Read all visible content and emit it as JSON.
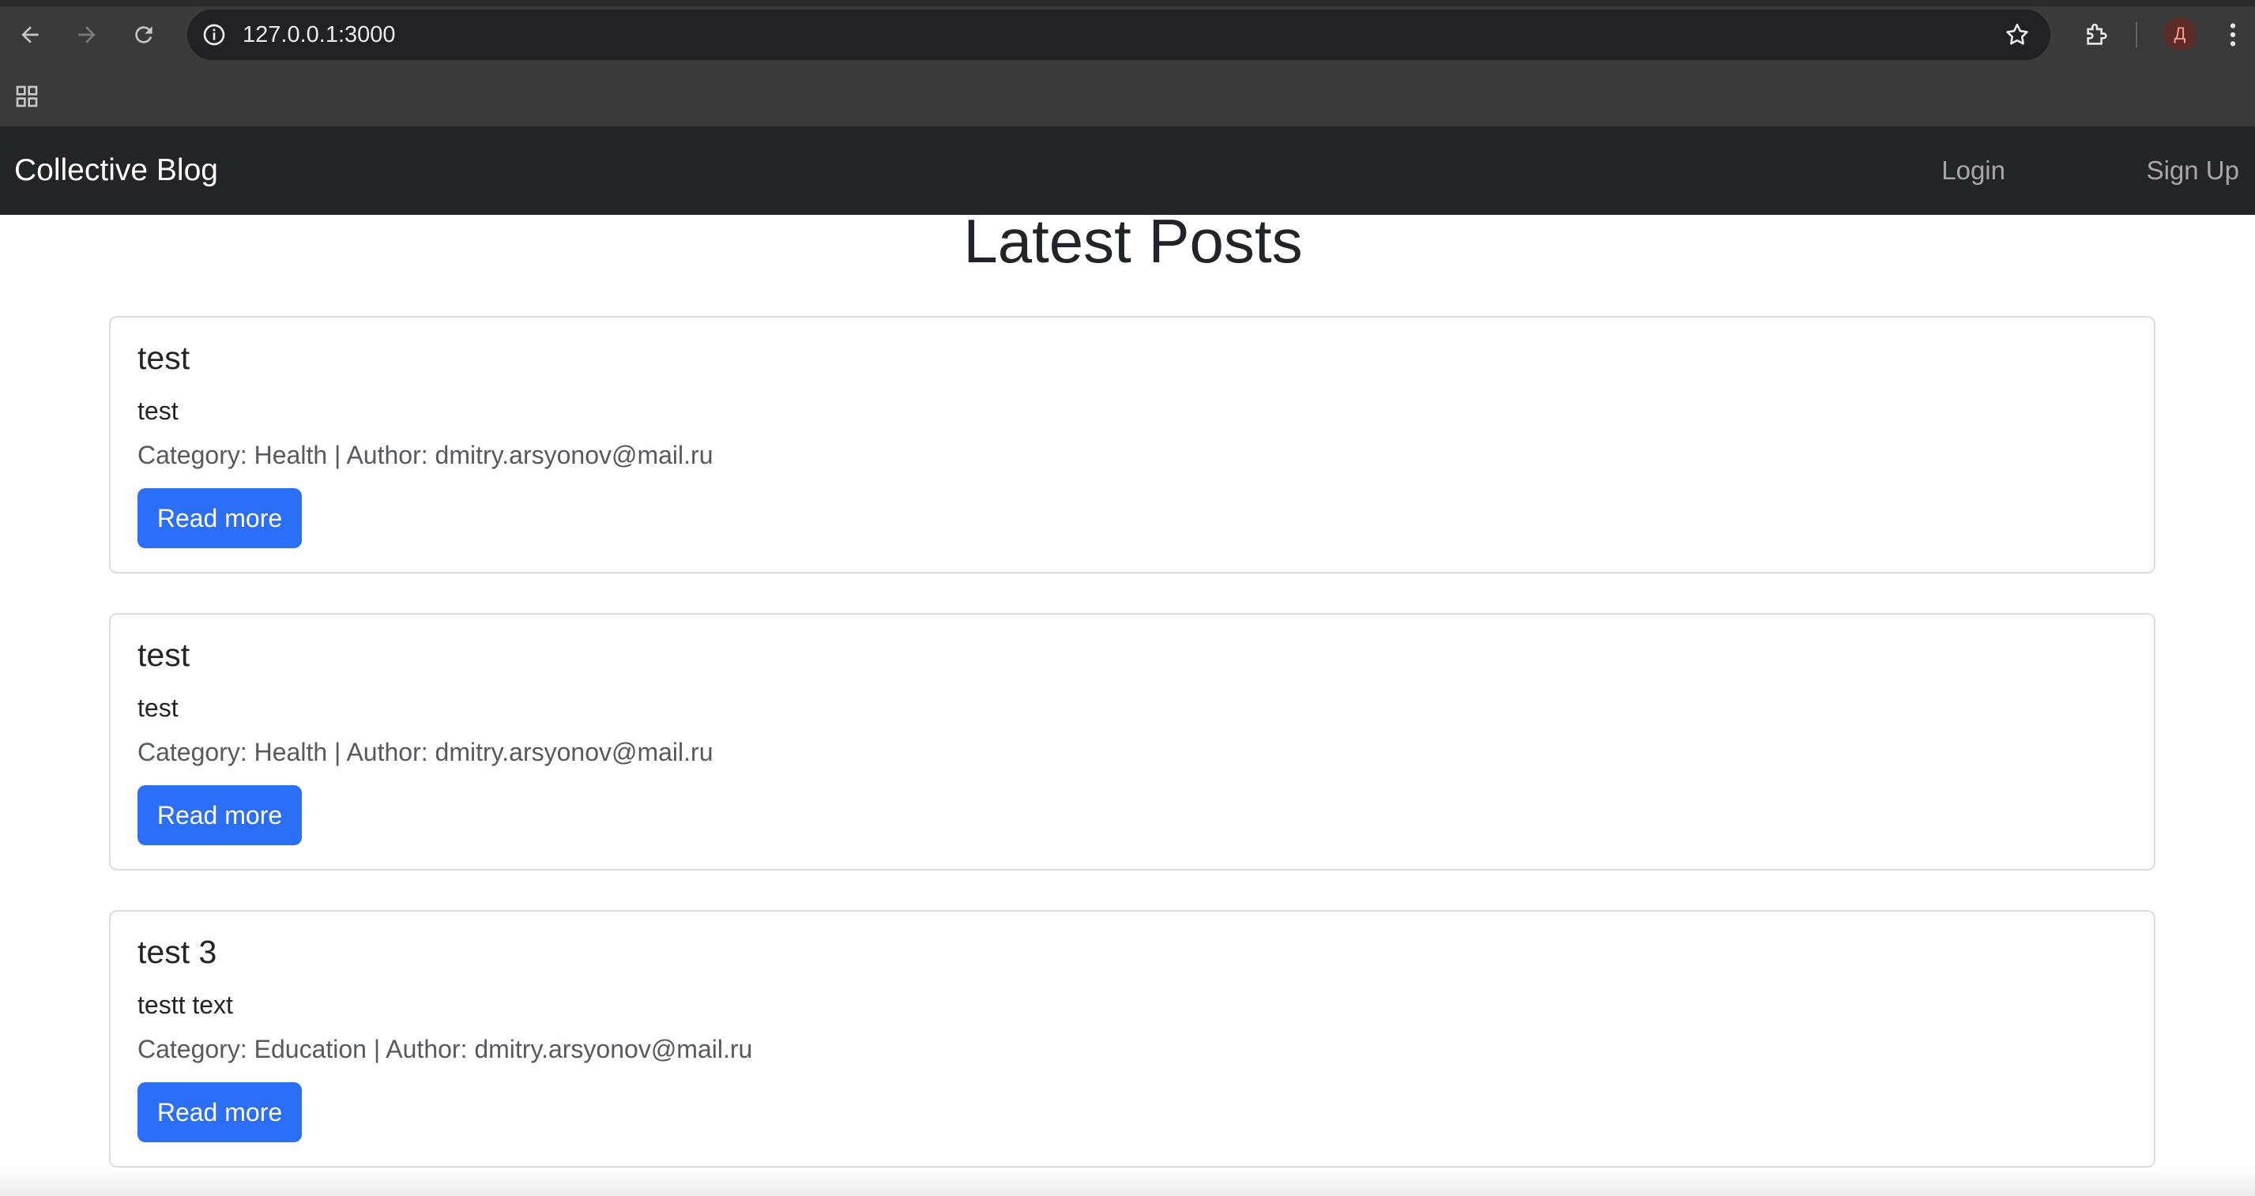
{
  "browser": {
    "url": "127.0.0.1:3000",
    "profile_initial": "Д",
    "icons": {
      "back": "arrow-left-icon",
      "forward": "arrow-right-icon",
      "reload": "reload-icon",
      "info": "info-icon",
      "bookmark": "star-icon",
      "extensions": "puzzle-icon",
      "menu": "kebab-menu-icon",
      "apps": "apps-grid-icon"
    }
  },
  "navbar": {
    "brand": "Collective Blog",
    "login": "Login",
    "signup": "Sign Up",
    "background": "#212529"
  },
  "main": {
    "title": "Latest Posts",
    "posts": [
      {
        "title": "test",
        "text": "test",
        "meta": "Category: Health | Author: dmitry.arsyonov@mail.ru",
        "button": "Read more"
      },
      {
        "title": "test",
        "text": "test",
        "meta": "Category: Health | Author: dmitry.arsyonov@mail.ru",
        "button": "Read more"
      },
      {
        "title": "test 3",
        "text": "testt text",
        "meta": "Category: Education | Author: dmitry.arsyonov@mail.ru",
        "button": "Read more"
      }
    ]
  },
  "colors": {
    "accent": "#2b6ef7",
    "chrome": "#3a3a3a"
  }
}
